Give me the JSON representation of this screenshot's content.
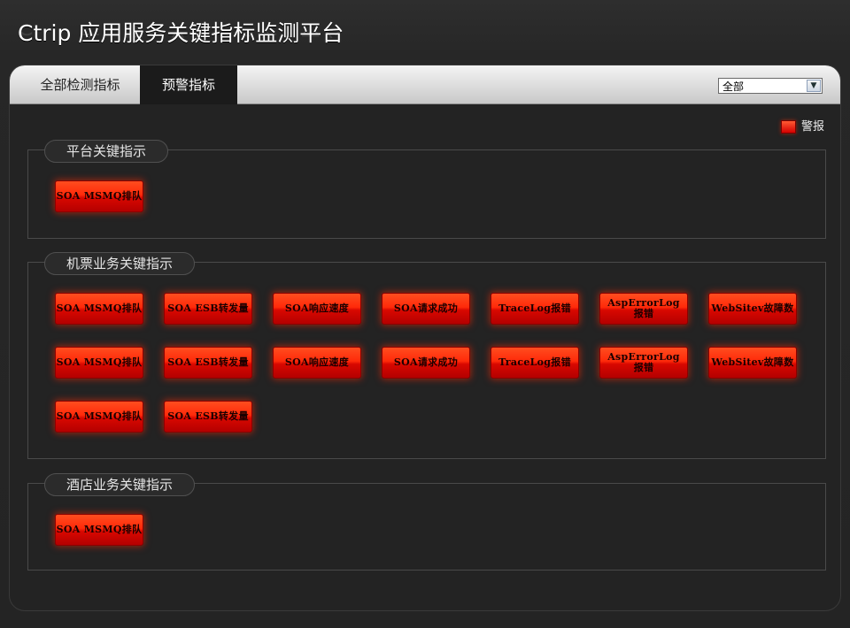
{
  "app": {
    "title": "Ctrip 应用服务关键指标监测平台"
  },
  "tabs": [
    {
      "label": "全部检测指标"
    },
    {
      "label": "预警指标"
    }
  ],
  "filter": {
    "selected": "全部"
  },
  "legend": {
    "label": "警报",
    "color": "#ff2a0a"
  },
  "groups": [
    {
      "title": "平台关键指示",
      "items": [
        "SOA MSMQ排队"
      ]
    },
    {
      "title": "机票业务关键指示",
      "items": [
        "SOA MSMQ排队",
        "SOA ESB转发量",
        "SOA响应速度",
        "SOA请求成功",
        "TraceLog报错",
        "AspErrorLog\n报错",
        "WebSitev故障数",
        "SOA MSMQ排队",
        "SOA ESB转发量",
        "SOA响应速度",
        "SOA请求成功",
        "TraceLog报错",
        "AspErrorLog\n报错",
        "WebSitev故障数",
        "SOA MSMQ排队",
        "SOA ESB转发量"
      ]
    },
    {
      "title": "酒店业务关键指示",
      "items": [
        "SOA MSMQ排队"
      ]
    }
  ]
}
